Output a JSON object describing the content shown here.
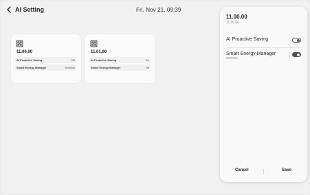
{
  "header": {
    "title": "AI Setting",
    "datetime": "Fri, Nov 21, 09:39",
    "back_icon": "chevron-left-icon"
  },
  "cards": [
    {
      "icon": "ac-unit-icon",
      "title": "11.00.00",
      "rows": [
        {
          "label": "AI Proactive Saving",
          "value": "Off"
        },
        {
          "label": "Smart Energy Manager",
          "value": "500kWh"
        }
      ]
    },
    {
      "icon": "ac-unit-icon",
      "title": "11.01.00",
      "rows": [
        {
          "label": "AI Proactive Saving",
          "value": "On"
        },
        {
          "label": "Smart Energy Manager",
          "value": "Off"
        }
      ]
    }
  ],
  "panel": {
    "title": "11.00.00",
    "subtitle": "11.00.00",
    "settings": [
      {
        "label": "AI Proactive Saving",
        "sub": "",
        "state": "off"
      },
      {
        "label": "Smart Energy Manager",
        "sub": "500kWh",
        "state": "on"
      }
    ],
    "cancel_label": "Cancel",
    "save_label": "Save"
  },
  "colors": {
    "background": "#ececec",
    "card": "#fafafa",
    "toggle_on": "#4d4d4d"
  }
}
